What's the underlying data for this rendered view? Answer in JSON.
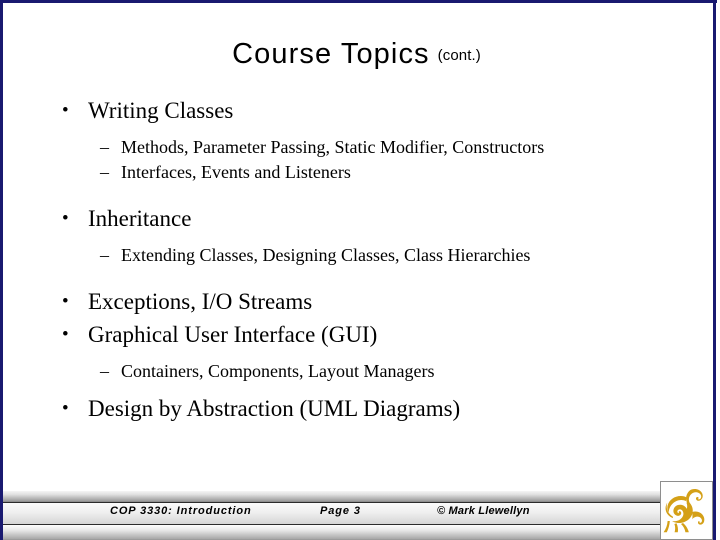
{
  "slide": {
    "title_main": "Course Topics",
    "title_suffix": "(cont.)",
    "frame_color": "#191970",
    "text_color": "#000000",
    "background_color": "#ffffff",
    "outline": [
      {
        "level": 1,
        "marker": "•",
        "text": "Writing Classes"
      },
      {
        "level": 2,
        "marker": "–",
        "text": "Methods, Parameter Passing, Static Modifier, Constructors"
      },
      {
        "level": 2,
        "marker": "–",
        "text": "Interfaces, Events and Listeners"
      },
      {
        "level": 1,
        "marker": "•",
        "text": "Inheritance"
      },
      {
        "level": 2,
        "marker": "–",
        "text": "Extending Classes, Designing Classes, Class Hierarchies"
      },
      {
        "level": 1,
        "marker": "•",
        "text": "Exceptions, I/O Streams"
      },
      {
        "level": 1,
        "marker": "•",
        "text": "Graphical User Interface (GUI)"
      },
      {
        "level": 2,
        "marker": "–",
        "text": "Containers, Components, Layout Managers"
      },
      {
        "level": 1,
        "marker": "•",
        "text": "Design by Abstraction (UML Diagrams)"
      }
    ]
  },
  "footer": {
    "course": "COP 3330:  Introduction",
    "page": "Page 3",
    "credit": "© Mark Llewellyn",
    "logo_name": "ucf-pegasus-logo",
    "logo_color": "#d4a017"
  }
}
